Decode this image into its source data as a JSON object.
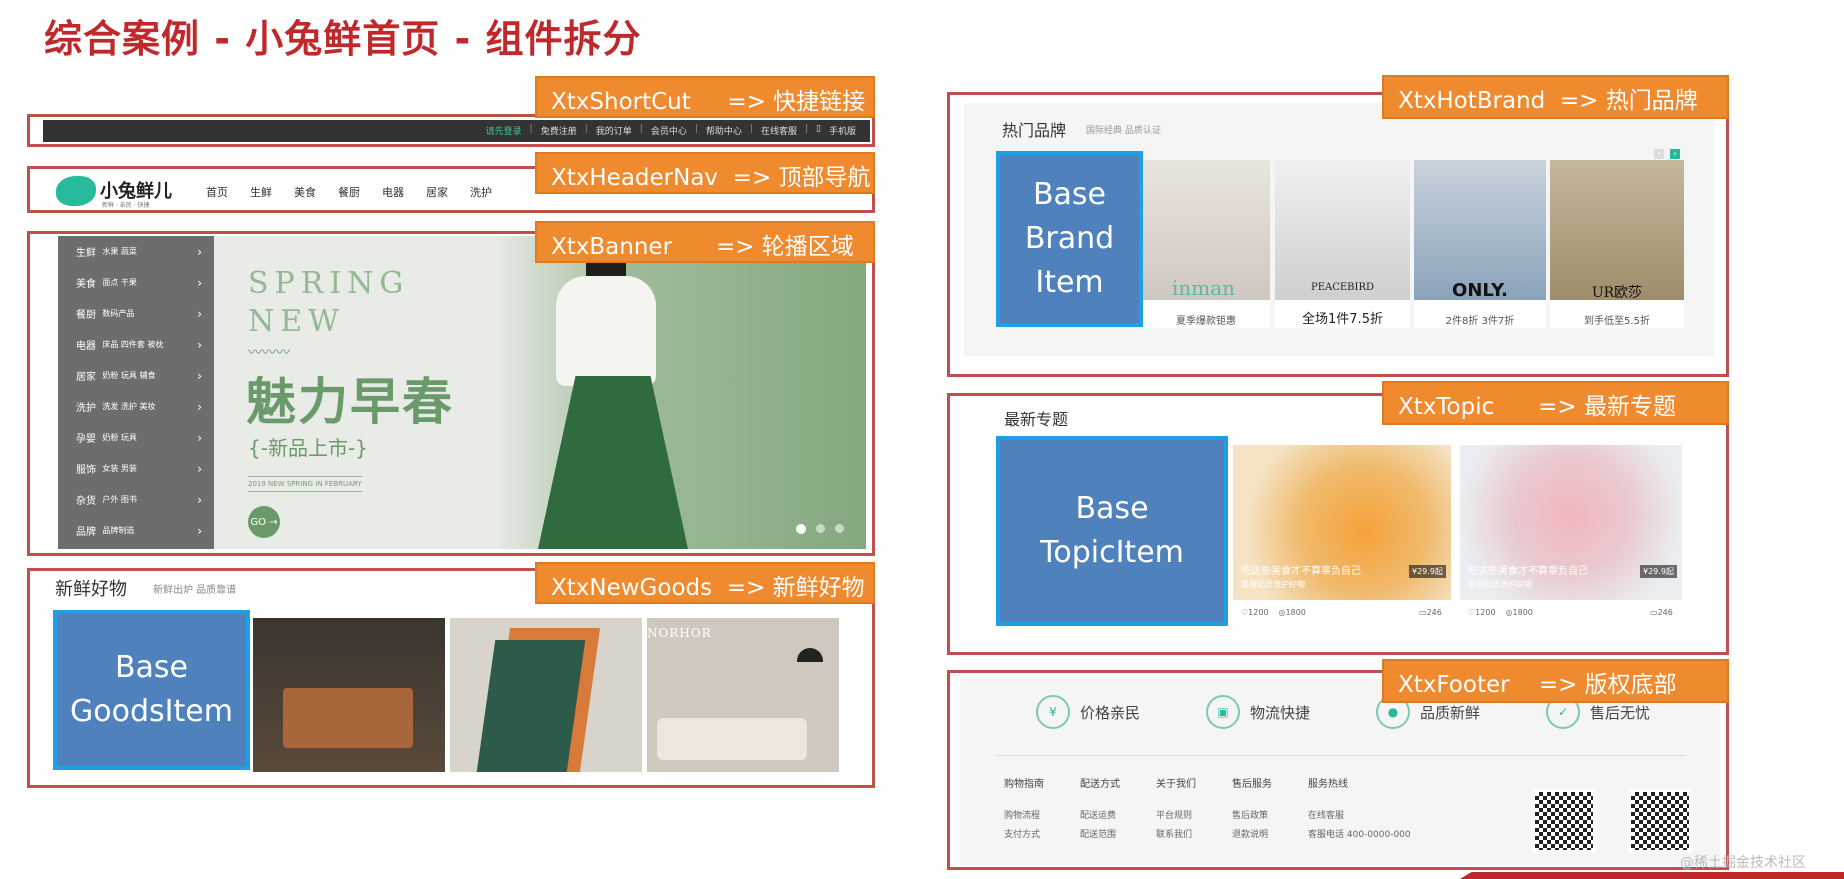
{
  "page_title": "综合案例 - 小兔鲜首页 - 组件拆分",
  "tags": {
    "shortcut": {
      "name": "XtxShortCut",
      "desc": "=> 快捷链接"
    },
    "headernav": {
      "name": "XtxHeaderNav",
      "desc": "=> 顶部导航"
    },
    "banner": {
      "name": "XtxBanner",
      "desc": "=> 轮播区域"
    },
    "newgoods": {
      "name": "XtxNewGoods",
      "desc": "=> 新鲜好物"
    },
    "hotbrand": {
      "name": "XtxHotBrand",
      "desc": "=> 热门品牌"
    },
    "topic": {
      "name": "XtxTopic",
      "desc": "=> 最新专题"
    },
    "footer": {
      "name": "XtxFooter",
      "desc": "=> 版权底部"
    }
  },
  "base_items": {
    "goods": "Base\nGoodsItem",
    "brand": "Base\nBrand\nItem",
    "topic": "Base\nTopicItem"
  },
  "shortcut_links": [
    "请先登录",
    "免费注册",
    "我的订单",
    "会员中心",
    "帮助中心",
    "在线客服",
    "手机版"
  ],
  "header_nav": {
    "logo": "小兔鲜儿",
    "logo_sub": "新鲜 · 亲民 · 快捷",
    "items": [
      "首页",
      "生鲜",
      "美食",
      "餐厨",
      "电器",
      "居家",
      "洗护"
    ]
  },
  "banner": {
    "categories": [
      {
        "name": "生鲜",
        "sub": "水果 蔬菜"
      },
      {
        "name": "美食",
        "sub": "面点 干果"
      },
      {
        "name": "餐厨",
        "sub": "数码产品"
      },
      {
        "name": "电器",
        "sub": "床品 四件套 被枕"
      },
      {
        "name": "居家",
        "sub": "奶粉 玩具 辅食"
      },
      {
        "name": "洗护",
        "sub": "洗发 洗护 美妆"
      },
      {
        "name": "孕婴",
        "sub": "奶粉 玩具"
      },
      {
        "name": "服饰",
        "sub": "女装 男装"
      },
      {
        "name": "杂货",
        "sub": "户外 图书"
      },
      {
        "name": "品牌",
        "sub": "品牌制造"
      }
    ],
    "spring_line1": "SPRING",
    "spring_line2": "NEW",
    "headline": "魅力早春",
    "subline": "{-新品上市-}",
    "small_line": "2019 NEW SPRING IN FEBRUARY",
    "go_button": "GO",
    "colors": {
      "sidebar": "#6d6d6d",
      "headline": "#6a9a6a",
      "bg": "#e8ebe6"
    }
  },
  "new_goods": {
    "title": "新鲜好物",
    "subtitle": "新鲜出炉 品质靠谱",
    "sofa_text": "NORHOR"
  },
  "hot_brand": {
    "title": "热门品牌",
    "subtitle": "国际经典 品质认证",
    "brands": [
      {
        "logo": "inman",
        "caption": "夏季爆款钜惠"
      },
      {
        "logo": "PEACEBIRD",
        "caption": "全场1件7.5折"
      },
      {
        "logo": "ONLY.",
        "caption": "2件8折 3件7折"
      },
      {
        "logo": "UR欧莎",
        "caption": "到手低至5.5折"
      }
    ]
  },
  "topic": {
    "title": "最新专题",
    "cards": [
      {
        "caption": "吃这些美食才不算辜负自己",
        "sub": "餐厨起居洗护好物",
        "price": "¥29.9起",
        "likes": "1200",
        "views": "1800",
        "comments": "246"
      },
      {
        "caption": "吃这些美食才不算辜负自己",
        "sub": "餐厨起居洗护好物",
        "price": "¥29.9起",
        "likes": "1200",
        "views": "1800",
        "comments": "246"
      }
    ]
  },
  "footer": {
    "features": [
      "价格亲民",
      "物流快捷",
      "品质新鲜",
      "售后无忧"
    ],
    "columns": [
      {
        "head": "购物指南",
        "links": [
          "购物流程",
          "支付方式"
        ]
      },
      {
        "head": "配送方式",
        "links": [
          "配送运费",
          "配送范围"
        ]
      },
      {
        "head": "关于我们",
        "links": [
          "平台规则",
          "联系我们"
        ]
      },
      {
        "head": "售后服务",
        "links": [
          "售后政策",
          "退款说明"
        ]
      },
      {
        "head": "服务热线",
        "links": [
          "在线客服",
          "客服电话 400-0000-000"
        ]
      }
    ]
  },
  "watermark": "@稀土掘金技术社区"
}
